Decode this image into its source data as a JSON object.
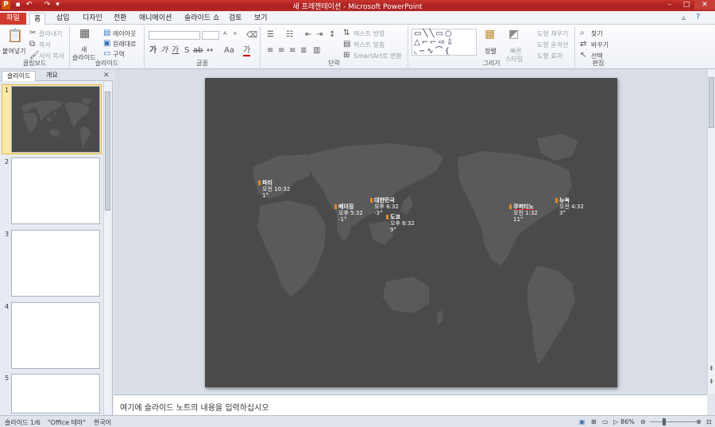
{
  "window": {
    "title": "새 프레젠테이션 - Microsoft PowerPoint"
  },
  "tabs": [
    "파일",
    "홈",
    "삽입",
    "디자인",
    "전환",
    "애니메이션",
    "슬라이드 쇼",
    "검토",
    "보기"
  ],
  "ribbon": {
    "clipboard": {
      "paste": "붙여넣기",
      "cut": "잘라내기",
      "copy": "복사",
      "format_painter": "서식 복사",
      "label": "클립보드"
    },
    "slides": {
      "new_slide": "새",
      "new_slide2": "슬라이드",
      "layout": "레이아웃",
      "reset": "원래대로",
      "section": "구역",
      "label": "슬라이드"
    },
    "font": {
      "label": "글꼴"
    },
    "paragraph": {
      "text_direction": "텍스트 방향",
      "align_text": "텍스트 맞춤",
      "smartart": "SmartArt로 변환",
      "label": "단락"
    },
    "drawing": {
      "arrange": "정렬",
      "quick_styles": "빠른",
      "quick_styles2": "스타일",
      "shape_fill": "도형 채우기",
      "shape_outline": "도형 윤곽선",
      "shape_effects": "도형 효과",
      "label": "그리기"
    },
    "editing": {
      "find": "찾기",
      "replace": "바꾸기",
      "select": "선택",
      "label": "편집"
    }
  },
  "panel": {
    "tabs": [
      "슬라이드",
      "개요"
    ],
    "thumb_numbers": [
      "1",
      "2",
      "3",
      "4",
      "5"
    ]
  },
  "slide": {
    "cities": [
      {
        "name": "파리",
        "time": "오전 10:32",
        "temp": "1°"
      },
      {
        "name": "베이징",
        "time": "오후 5:32",
        "temp": "-1°"
      },
      {
        "name": "대한민국",
        "time": "오후 6:32",
        "temp": "-3°"
      },
      {
        "name": "도쿄",
        "time": "오후 6:32",
        "temp": "9°"
      },
      {
        "name": "쿠퍼티노",
        "time": "오전 1:32",
        "temp": "11°"
      },
      {
        "name": "뉴욕",
        "time": "오전 4:32",
        "temp": "3°"
      }
    ]
  },
  "notes": {
    "placeholder": "여기에 슬라이드 노트의 내용을 입력하십시오"
  },
  "status": {
    "slide": "슬라이드 1/6",
    "theme": "\"Office 테마\"",
    "lang": "한국어",
    "zoom": "86%"
  },
  "colors": {
    "slide_bg": "#4a4a4a",
    "continents": "#5a5a5a",
    "pin": "#e58a1f",
    "title_bar": "#b52a27"
  }
}
